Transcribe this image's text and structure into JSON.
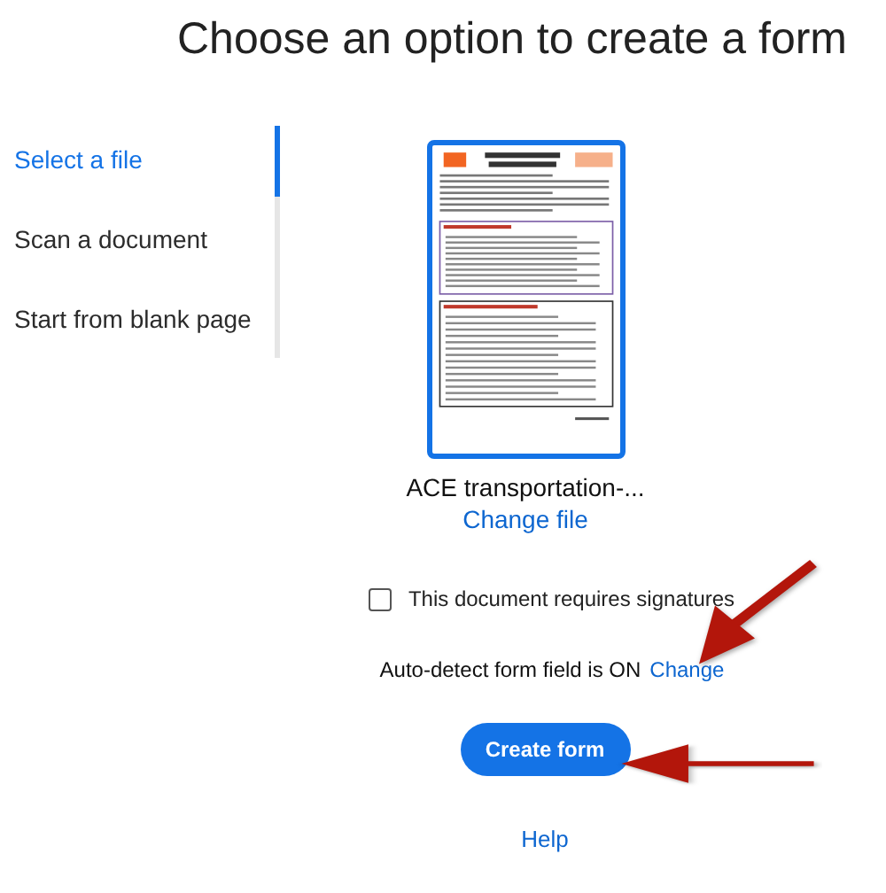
{
  "title": "Choose an option to create a form",
  "sidebar": {
    "items": [
      {
        "label": "Select a file",
        "selected": true
      },
      {
        "label": "Scan a document",
        "selected": false
      },
      {
        "label": "Start from blank page",
        "selected": false
      }
    ]
  },
  "file": {
    "name": "ACE transportation-...",
    "change_link": "Change file"
  },
  "signatures": {
    "label": "This document requires signatures",
    "checked": false
  },
  "auto_detect": {
    "text": "Auto-detect form field is ON",
    "link": "Change"
  },
  "primary_button": "Create form",
  "help_link": "Help"
}
